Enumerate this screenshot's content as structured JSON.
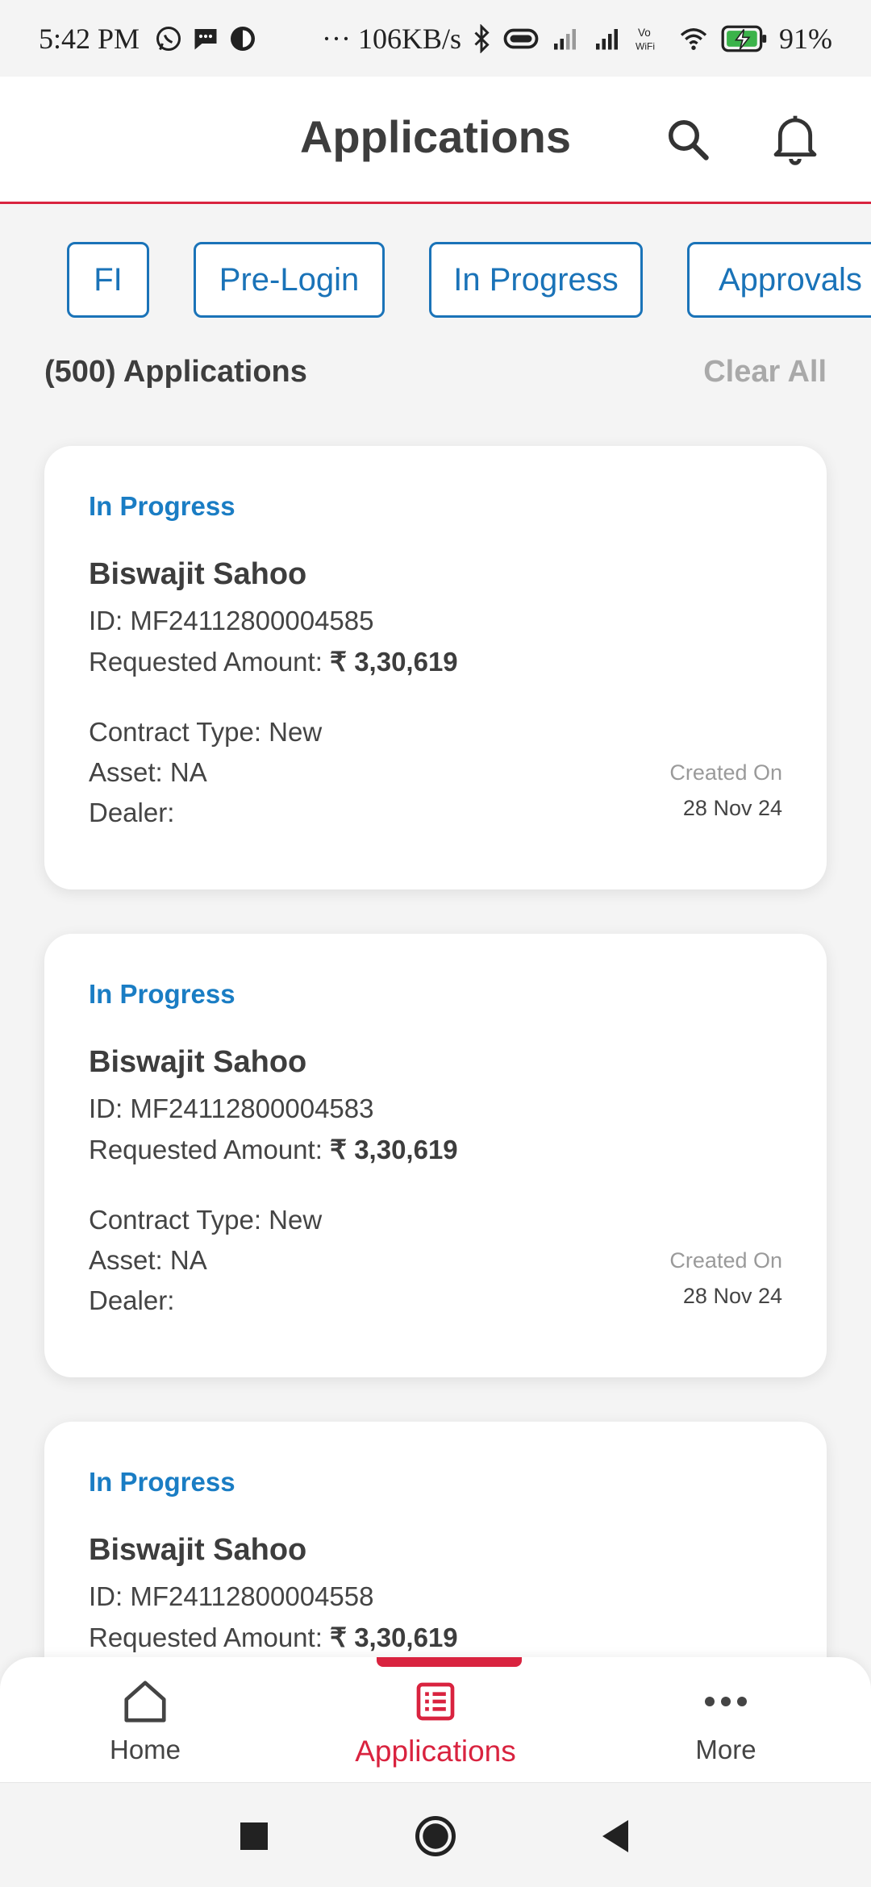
{
  "status_bar": {
    "time": "5:42 PM",
    "speed": "··· 106KB/s",
    "battery": "91%",
    "icons": [
      "whatsapp-icon",
      "message-icon",
      "app-icon",
      "bluetooth-icon",
      "vibrate-icon",
      "signal-icon",
      "signal-icon",
      "vowifi-icon",
      "wifi-icon",
      "battery-charging-icon"
    ]
  },
  "header": {
    "title": "Applications",
    "search_icon": "search-icon",
    "bell_icon": "bell-icon",
    "accent_color": "#d9233f"
  },
  "filters": {
    "chips": [
      "FI",
      "Pre-Login",
      "In Progress",
      "Approvals"
    ],
    "chip_color": "#1a73b8"
  },
  "summary": {
    "count_label": "(500) Applications",
    "clear_label": "Clear All"
  },
  "applications": [
    {
      "status": "In Progress",
      "name": "Biswajit  Sahoo",
      "id_label": "ID: MF24112800004585",
      "amount_prefix": "Requested Amount: ",
      "amount": "₹ 3,30,619",
      "contract": "Contract Type: New",
      "asset": "Asset: NA",
      "dealer": "Dealer:",
      "created_label": "Created On",
      "created_date": "28 Nov 24"
    },
    {
      "status": "In Progress",
      "name": "Biswajit  Sahoo",
      "id_label": "ID: MF24112800004583",
      "amount_prefix": "Requested Amount: ",
      "amount": "₹ 3,30,619",
      "contract": "Contract Type: New",
      "asset": "Asset: NA",
      "dealer": "Dealer:",
      "created_label": "Created On",
      "created_date": "28 Nov 24"
    },
    {
      "status": "In Progress",
      "name": "Biswajit  Sahoo",
      "id_label": "ID: MF24112800004558",
      "amount_prefix": "Requested Amount: ",
      "amount": "₹ 3,30,619"
    }
  ],
  "bottom_nav": {
    "items": [
      {
        "label": "Home",
        "icon": "home-icon"
      },
      {
        "label": "Applications",
        "icon": "applications-icon"
      },
      {
        "label": "More",
        "icon": "more-icon"
      }
    ],
    "active_index": 1
  },
  "system_nav": [
    "recents-icon",
    "home-circle-icon",
    "back-icon"
  ]
}
